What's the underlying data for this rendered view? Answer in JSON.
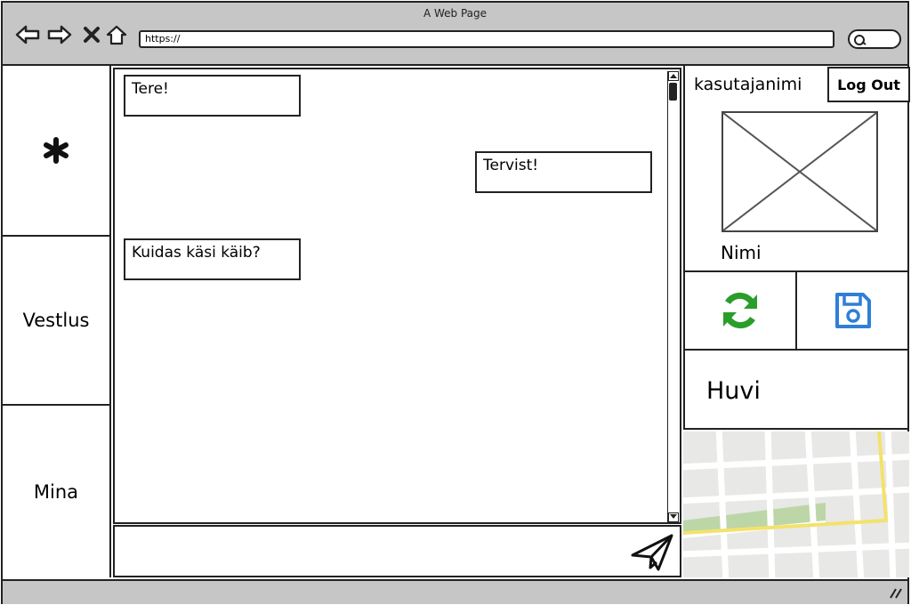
{
  "window": {
    "title": "A Web Page"
  },
  "browser": {
    "url": "https://",
    "icons": [
      "back-arrow-icon",
      "forward-arrow-icon",
      "close-icon",
      "home-icon",
      "search-icon"
    ]
  },
  "sidebar": {
    "items": [
      {
        "label": "",
        "icon": "asterisk-icon"
      },
      {
        "label": "Vestlus"
      },
      {
        "label": "Mina"
      }
    ]
  },
  "chat": {
    "messages": [
      {
        "text": "Tere!",
        "side": "left"
      },
      {
        "text": "Tervist!",
        "side": "right"
      },
      {
        "text": "Kuidas käsi käib?",
        "side": "left"
      }
    ],
    "send_icon": "paper-plane-icon"
  },
  "profile": {
    "username": "kasutajanimi",
    "logout_label": "Log Out",
    "name_label": "Nimi",
    "avatar_icon": "image-placeholder-icon"
  },
  "actions": {
    "refresh_icon": "refresh-icon",
    "save_icon": "save-floppy-icon",
    "colors": {
      "refresh": "#2a9d2a",
      "save": "#2f7fd8"
    }
  },
  "interest": {
    "label": "Huvi"
  },
  "colors": {
    "chrome": "#c6c6c6",
    "border": "#222222"
  }
}
